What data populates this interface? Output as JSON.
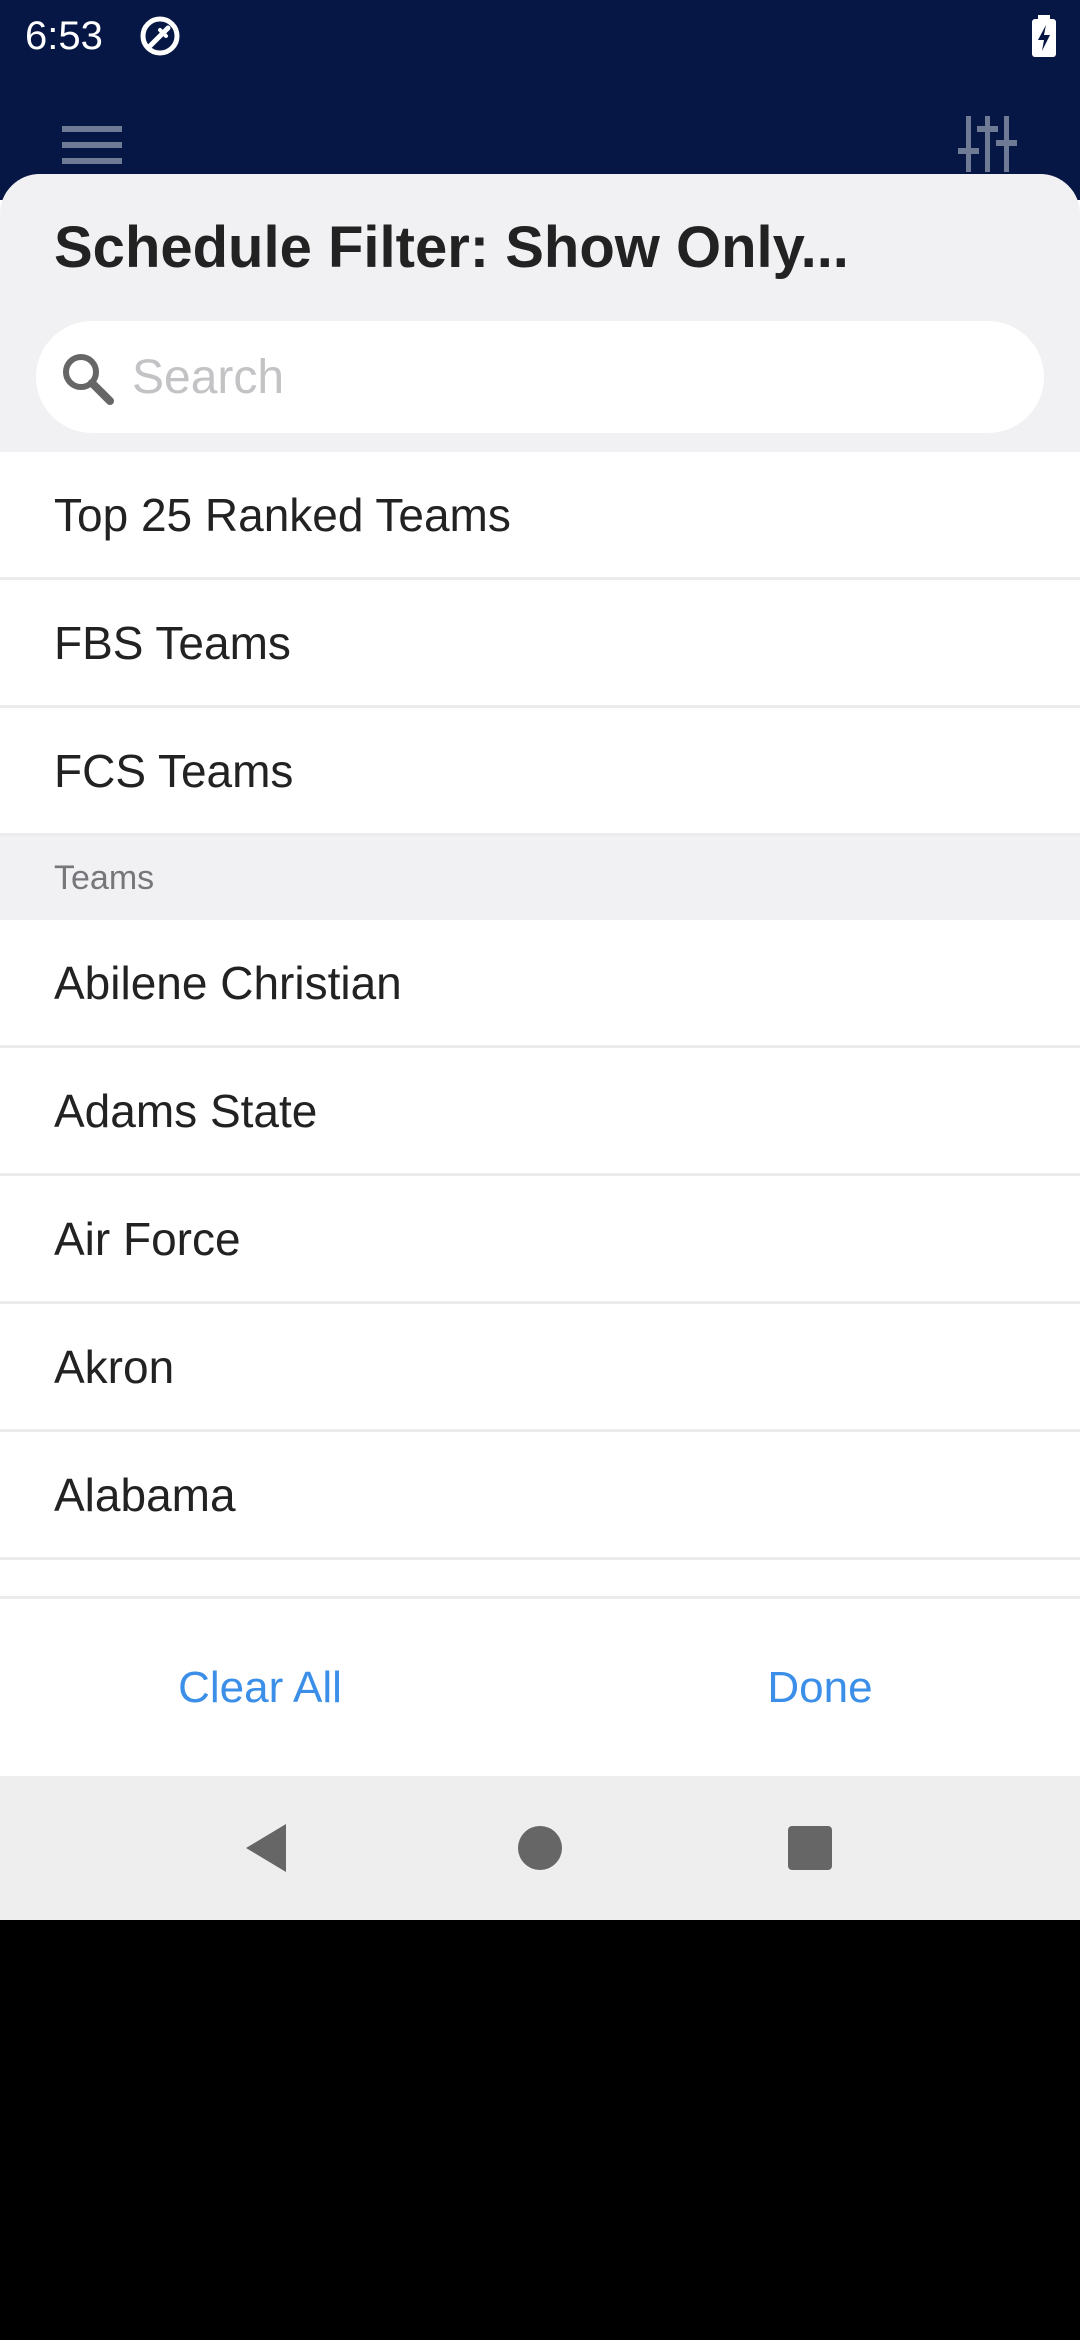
{
  "status_bar": {
    "time": "6:53",
    "icons": [
      "app-notification-icon",
      "battery-charging-icon"
    ]
  },
  "app_bar": {
    "icons": [
      "menu-icon",
      "filter-sliders-icon"
    ]
  },
  "sheet": {
    "title": "Schedule Filter: Show Only...",
    "search": {
      "placeholder": "Search",
      "value": ""
    },
    "quick_filters": [
      {
        "label": "Top 25 Ranked Teams"
      },
      {
        "label": "FBS Teams"
      },
      {
        "label": "FCS Teams"
      }
    ],
    "teams_header": "Teams",
    "teams": [
      {
        "label": "Abilene Christian"
      },
      {
        "label": "Adams State"
      },
      {
        "label": "Air Force"
      },
      {
        "label": "Akron"
      },
      {
        "label": "Alabama"
      }
    ],
    "footer": {
      "clear_label": "Clear All",
      "done_label": "Done"
    }
  },
  "nav_bar": {
    "icons": [
      "back-icon",
      "home-icon",
      "recents-icon"
    ]
  },
  "colors": {
    "header_bg": "#061745",
    "accent": "#3b8fe8",
    "sheet_top_bg": "#f1f1f3",
    "divider": "#ececee"
  }
}
